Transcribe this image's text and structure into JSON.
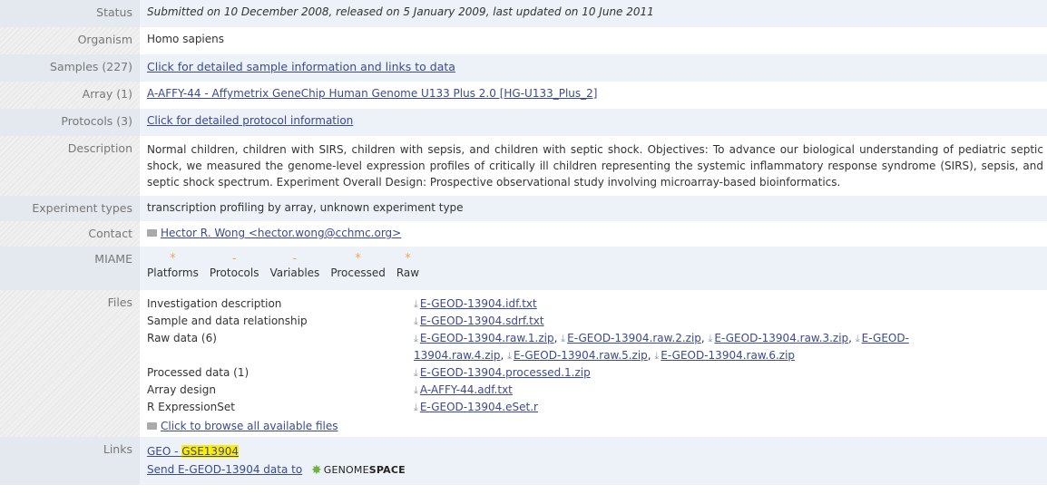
{
  "rows": {
    "status": {
      "label": "Status",
      "text": "Submitted on 10 December 2008, released on 5 January 2009, last updated on 10 June 2011"
    },
    "organism": {
      "label": "Organism",
      "text": "Homo sapiens"
    },
    "samples": {
      "label": "Samples (227)",
      "link": "Click for detailed sample information and links to data"
    },
    "array": {
      "label": "Array (1)",
      "link": "A-AFFY-44 - Affymetrix GeneChip Human Genome U133 Plus 2.0 [HG-U133_Plus_2]"
    },
    "protocols": {
      "label": "Protocols (3)",
      "link": "Click for detailed protocol information"
    },
    "description": {
      "label": "Description",
      "text": "Normal children, children with SIRS, children with sepsis, and children with septic shock. Objectives: To advance our biological understanding of pediatric septic shock, we measured the genome-level expression profiles of critically ill children representing the systemic inflammatory response syndrome (SIRS), sepsis, and septic shock spectrum. Experiment Overall Design: Prospective observational study involving microarray-based bioinformatics."
    },
    "experiment_types": {
      "label": "Experiment types",
      "text": "transcription profiling by array, unknown experiment type"
    },
    "contact": {
      "label": "Contact",
      "link": "Hector R. Wong <hector.wong@cchmc.org>"
    },
    "miame": {
      "label": "MIAME",
      "items": [
        {
          "name": "Platforms",
          "mark": "*"
        },
        {
          "name": "Protocols",
          "mark": "-"
        },
        {
          "name": "Variables",
          "mark": "-"
        },
        {
          "name": "Processed",
          "mark": "*"
        },
        {
          "name": "Raw",
          "mark": "*"
        }
      ]
    },
    "files": {
      "label": "Files",
      "investigation": {
        "name": "Investigation description",
        "file": "E-GEOD-13904.idf.txt"
      },
      "sample_rel": {
        "name": "Sample and data relationship",
        "file": "E-GEOD-13904.sdrf.txt"
      },
      "raw": {
        "name": "Raw data (6)",
        "files": [
          "E-GEOD-13904.raw.1.zip",
          "E-GEOD-13904.raw.2.zip",
          "E-GEOD-13904.raw.3.zip",
          "E-GEOD-13904.raw.4.zip",
          "E-GEOD-13904.raw.5.zip",
          "E-GEOD-13904.raw.6.zip"
        ]
      },
      "processed": {
        "name": "Processed data (1)",
        "file": "E-GEOD-13904.processed.1.zip"
      },
      "array_design": {
        "name": "Array design",
        "file": "A-AFFY-44.adf.txt"
      },
      "r_set": {
        "name": "R ExpressionSet",
        "file": "E-GEOD-13904.eSet.r"
      },
      "browse": "Click to browse all available files"
    },
    "links": {
      "label": "Links",
      "geo_prefix": "GEO - ",
      "geo_id": "GSE13904",
      "send": "Send E-GEOD-13904 data to",
      "genomespace_a": "GENOME",
      "genomespace_b": "SPACE"
    }
  },
  "colors": {
    "label_bg": "#f0f0f0",
    "alt_row": "#edf1f8",
    "link": "#3d4a8c",
    "miame_mark": "#f0a94a",
    "highlight": "#ffee00"
  }
}
